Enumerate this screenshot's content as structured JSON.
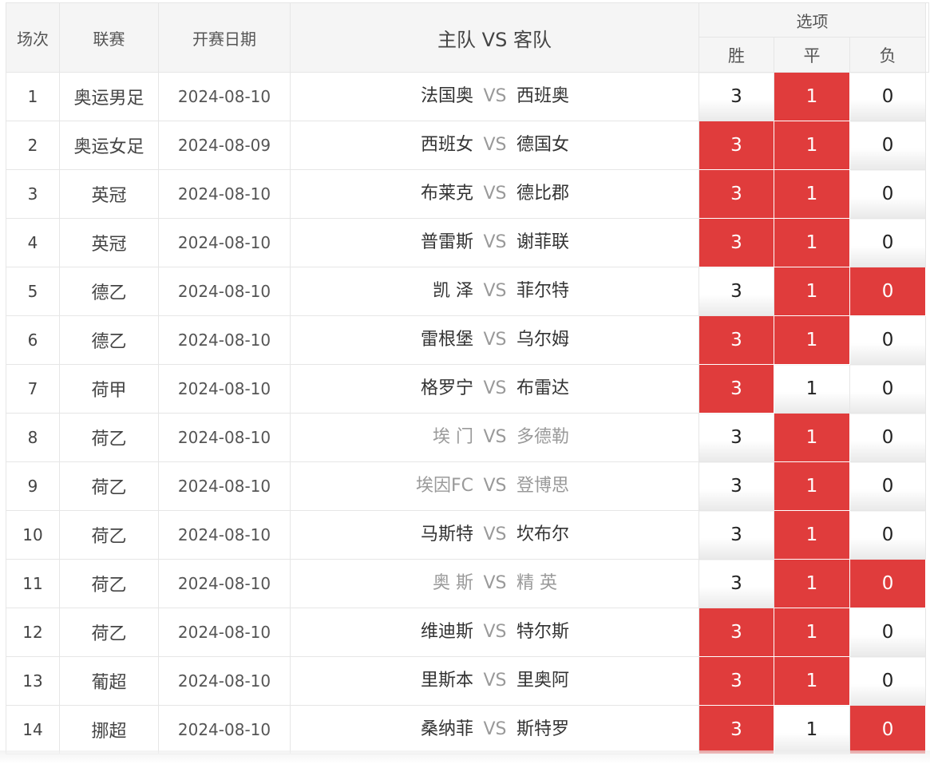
{
  "header": {
    "no": "场次",
    "league": "联赛",
    "date": "开赛日期",
    "match": "主队 VS 客队",
    "options": "选项",
    "win": "胜",
    "draw": "平",
    "lose": "负"
  },
  "vs_label": "VS",
  "colors": {
    "selected": "#e03c3c",
    "muted_team": "#9a9a9a"
  },
  "rows": [
    {
      "no": "1",
      "league": "奥运男足",
      "date": "2024-08-10",
      "home": "法国奥",
      "away": "西班奥",
      "muted": false,
      "win": "3",
      "draw": "1",
      "lose": "0",
      "sel": [
        false,
        true,
        false
      ]
    },
    {
      "no": "2",
      "league": "奥运女足",
      "date": "2024-08-09",
      "home": "西班女",
      "away": "德国女",
      "muted": false,
      "win": "3",
      "draw": "1",
      "lose": "0",
      "sel": [
        true,
        true,
        false
      ]
    },
    {
      "no": "3",
      "league": "英冠",
      "date": "2024-08-10",
      "home": "布莱克",
      "away": "德比郡",
      "muted": false,
      "win": "3",
      "draw": "1",
      "lose": "0",
      "sel": [
        true,
        true,
        false
      ]
    },
    {
      "no": "4",
      "league": "英冠",
      "date": "2024-08-10",
      "home": "普雷斯",
      "away": "谢菲联",
      "muted": false,
      "win": "3",
      "draw": "1",
      "lose": "0",
      "sel": [
        true,
        true,
        false
      ]
    },
    {
      "no": "5",
      "league": "德乙",
      "date": "2024-08-10",
      "home": "凯 泽",
      "away": "菲尔特",
      "muted": false,
      "win": "3",
      "draw": "1",
      "lose": "0",
      "sel": [
        false,
        true,
        true
      ]
    },
    {
      "no": "6",
      "league": "德乙",
      "date": "2024-08-10",
      "home": "雷根堡",
      "away": "乌尔姆",
      "muted": false,
      "win": "3",
      "draw": "1",
      "lose": "0",
      "sel": [
        true,
        true,
        false
      ]
    },
    {
      "no": "7",
      "league": "荷甲",
      "date": "2024-08-10",
      "home": "格罗宁",
      "away": "布雷达",
      "muted": false,
      "win": "3",
      "draw": "1",
      "lose": "0",
      "sel": [
        true,
        false,
        false
      ]
    },
    {
      "no": "8",
      "league": "荷乙",
      "date": "2024-08-10",
      "home": "埃 门",
      "away": "多德勒",
      "muted": true,
      "win": "3",
      "draw": "1",
      "lose": "0",
      "sel": [
        false,
        true,
        false
      ]
    },
    {
      "no": "9",
      "league": "荷乙",
      "date": "2024-08-10",
      "home": "埃因FC",
      "away": "登博思",
      "muted": true,
      "win": "3",
      "draw": "1",
      "lose": "0",
      "sel": [
        false,
        true,
        false
      ]
    },
    {
      "no": "10",
      "league": "荷乙",
      "date": "2024-08-10",
      "home": "马斯特",
      "away": "坎布尔",
      "muted": false,
      "win": "3",
      "draw": "1",
      "lose": "0",
      "sel": [
        false,
        true,
        false
      ]
    },
    {
      "no": "11",
      "league": "荷乙",
      "date": "2024-08-10",
      "home": "奥 斯",
      "away": "精 英",
      "muted": true,
      "win": "3",
      "draw": "1",
      "lose": "0",
      "sel": [
        false,
        true,
        true
      ]
    },
    {
      "no": "12",
      "league": "荷乙",
      "date": "2024-08-10",
      "home": "维迪斯",
      "away": "特尔斯",
      "muted": false,
      "win": "3",
      "draw": "1",
      "lose": "0",
      "sel": [
        true,
        true,
        false
      ]
    },
    {
      "no": "13",
      "league": "葡超",
      "date": "2024-08-10",
      "home": "里斯本",
      "away": "里奥阿",
      "muted": false,
      "win": "3",
      "draw": "1",
      "lose": "0",
      "sel": [
        true,
        true,
        false
      ]
    },
    {
      "no": "14",
      "league": "挪超",
      "date": "2024-08-10",
      "home": "桑纳菲",
      "away": "斯特罗",
      "muted": false,
      "win": "3",
      "draw": "1",
      "lose": "0",
      "sel": [
        true,
        false,
        true
      ]
    }
  ]
}
